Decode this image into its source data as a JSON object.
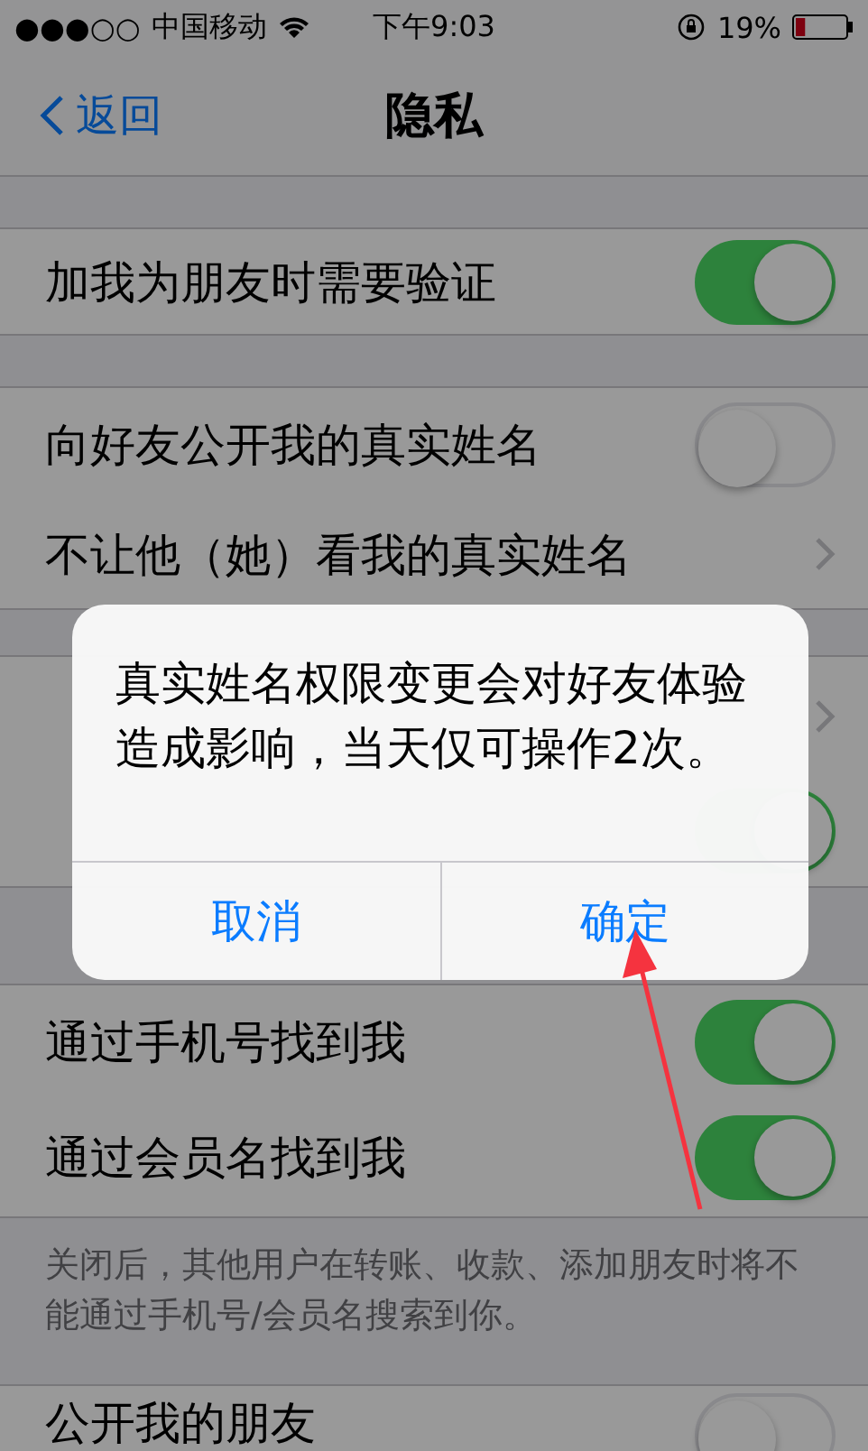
{
  "status_bar": {
    "signal": "●●●○○",
    "carrier": "中国移动",
    "time": "下午9:03",
    "battery": "19%"
  },
  "nav": {
    "back": "返回",
    "title": "隐私"
  },
  "sections": [
    {
      "rows": [
        {
          "kind": "toggle",
          "label": "加我为朋友时需要验证",
          "on": true
        }
      ]
    },
    {
      "rows": [
        {
          "kind": "toggle",
          "label": "向好友公开我的真实姓名",
          "on": false
        },
        {
          "kind": "link",
          "label": "不让他（她）看我的真实姓名"
        }
      ]
    },
    {
      "rows": [
        {
          "kind": "link"
        },
        {
          "kind": "toggle",
          "on": true
        }
      ]
    },
    {
      "rows": [
        {
          "kind": "toggle",
          "label": "通过手机号找到我",
          "on": true
        },
        {
          "kind": "toggle",
          "label": "通过会员名找到我",
          "on": true
        }
      ],
      "footer": "关闭后，其他用户在转账、收款、添加朋友时将不能通过手机号/会员名搜索到你。"
    },
    {
      "rows": [
        {
          "kind": "toggle",
          "label": "公开我的朋友",
          "on": false
        }
      ]
    }
  ],
  "dialog": {
    "message": "真实姓名权限变更会对好友体验造成影响，当天仅可操作2次。",
    "buttons": [
      "取消",
      "确定"
    ]
  }
}
